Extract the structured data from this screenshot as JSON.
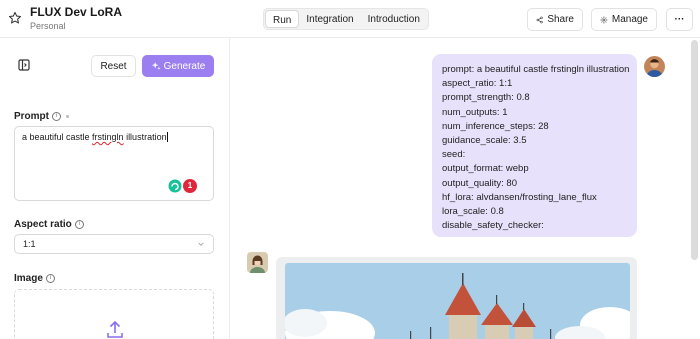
{
  "header": {
    "title": "FLUX Dev LoRA",
    "subtitle": "Personal",
    "tabs": [
      {
        "label": "Run",
        "active": true
      },
      {
        "label": "Integration",
        "active": false
      },
      {
        "label": "Introduction",
        "active": false
      }
    ],
    "share_label": "Share",
    "manage_label": "Manage",
    "more_label": "···"
  },
  "left_panel": {
    "reset_label": "Reset",
    "generate_label": "Generate",
    "prompt": {
      "label": "Prompt",
      "text_before": "a beautiful castle ",
      "text_misspelled": "frstingln",
      "text_after": " illustration",
      "grammarly_badge": "1"
    },
    "aspect_ratio": {
      "label": "Aspect ratio",
      "value": "1:1"
    },
    "image": {
      "label": "Image"
    }
  },
  "chat": {
    "request_lines": [
      "prompt: a beautiful castle frstingln illustration",
      "aspect_ratio: 1:1",
      "prompt_strength: 0.8",
      "num_outputs: 1",
      "num_inference_steps: 28",
      "guidance_scale: 3.5",
      "seed:",
      "output_format: webp",
      "output_quality: 80",
      "hf_lora: alvdansen/frosting_lane_flux",
      "lora_scale: 0.8",
      "disable_safety_checker:"
    ]
  },
  "colors": {
    "accent": "#9b7ff0",
    "bubble": "#e8e1fb",
    "border": "#e2e2e2"
  },
  "icons": [
    "star-icon",
    "panel-toggle-icon",
    "sparkle-icon",
    "share-icon",
    "gear-icon",
    "info-icon",
    "chevron-down-icon",
    "upload-icon",
    "grammarly-icon"
  ]
}
